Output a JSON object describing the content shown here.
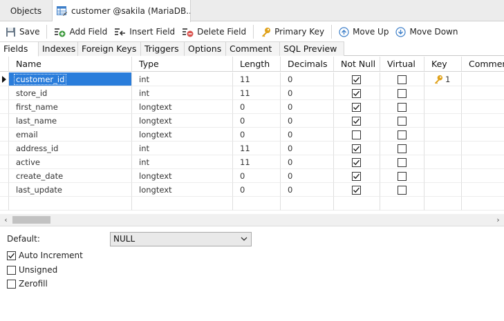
{
  "window_tabs": {
    "objects": "Objects",
    "document": "customer @sakila (MariaDB..."
  },
  "toolbar": {
    "save": "Save",
    "add_field": "Add Field",
    "insert_field": "Insert Field",
    "delete_field": "Delete Field",
    "primary_key": "Primary Key",
    "move_up": "Move Up",
    "move_down": "Move Down"
  },
  "subtabs": [
    "Fields",
    "Indexes",
    "Foreign Keys",
    "Triggers",
    "Options",
    "Comment",
    "SQL Preview"
  ],
  "grid": {
    "columns": [
      "Name",
      "Type",
      "Length",
      "Decimals",
      "Not Null",
      "Virtual",
      "Key",
      "Comment"
    ],
    "rows": [
      {
        "name": "customer_id",
        "type": "int",
        "length": "11",
        "decimals": "0",
        "not_null": true,
        "virtual": false,
        "key": "1"
      },
      {
        "name": "store_id",
        "type": "int",
        "length": "11",
        "decimals": "0",
        "not_null": true,
        "virtual": false,
        "key": ""
      },
      {
        "name": "first_name",
        "type": "longtext",
        "length": "0",
        "decimals": "0",
        "not_null": true,
        "virtual": false,
        "key": ""
      },
      {
        "name": "last_name",
        "type": "longtext",
        "length": "0",
        "decimals": "0",
        "not_null": true,
        "virtual": false,
        "key": ""
      },
      {
        "name": "email",
        "type": "longtext",
        "length": "0",
        "decimals": "0",
        "not_null": false,
        "virtual": false,
        "key": ""
      },
      {
        "name": "address_id",
        "type": "int",
        "length": "11",
        "decimals": "0",
        "not_null": true,
        "virtual": false,
        "key": ""
      },
      {
        "name": "active",
        "type": "int",
        "length": "11",
        "decimals": "0",
        "not_null": true,
        "virtual": false,
        "key": ""
      },
      {
        "name": "create_date",
        "type": "longtext",
        "length": "0",
        "decimals": "0",
        "not_null": true,
        "virtual": false,
        "key": ""
      },
      {
        "name": "last_update",
        "type": "longtext",
        "length": "0",
        "decimals": "0",
        "not_null": true,
        "virtual": false,
        "key": ""
      }
    ]
  },
  "properties": {
    "default_label": "Default:",
    "default_value": "NULL",
    "auto_increment": {
      "label": "Auto Increment",
      "checked": true
    },
    "unsigned": {
      "label": "Unsigned",
      "checked": false
    },
    "zerofill": {
      "label": "Zerofill",
      "checked": false
    }
  },
  "colors": {
    "selection": "#2a7ddb",
    "key_icon": "#e0a21b",
    "add_icon": "#3c9a3c",
    "delete_icon": "#d9534f",
    "move_icon": "#3d7fc9"
  }
}
